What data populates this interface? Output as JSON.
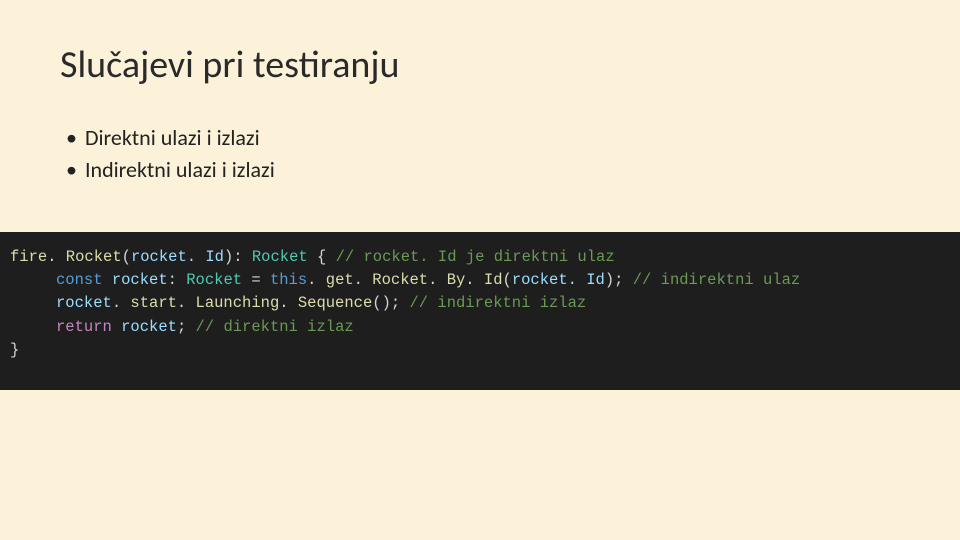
{
  "title": "Slučajevi pri testiranju",
  "bullets": [
    "Direktni ulazi i izlazi",
    "Indirektni ulazi i izlazi"
  ],
  "code": {
    "l1": {
      "fn": "fire. Rocket",
      "p1": "(",
      "arg": "rocket. Id",
      "p2": "): ",
      "type": "Rocket",
      "p3": " { ",
      "cmt": "// rocket. Id je direktni ulaz"
    },
    "l2": {
      "kw": "const ",
      "var": "rocket",
      "p1": ": ",
      "type": "Rocket",
      "p2": " = ",
      "this": "this",
      "p3": ". ",
      "fn": "get. Rocket. By. Id",
      "p4": "(",
      "arg": "rocket. Id",
      "p5": "); ",
      "cmt": "// indirektni ulaz"
    },
    "l3": {
      "obj": "rocket",
      "p1": ". ",
      "fn": "start. Launching. Sequence",
      "p2": "(); ",
      "cmt": "// indirektni izlaz"
    },
    "l4": {
      "kw": "return ",
      "var": "rocket",
      "p1": "; ",
      "cmt": "// direktni izlaz"
    },
    "l5": {
      "brace": "}"
    }
  }
}
